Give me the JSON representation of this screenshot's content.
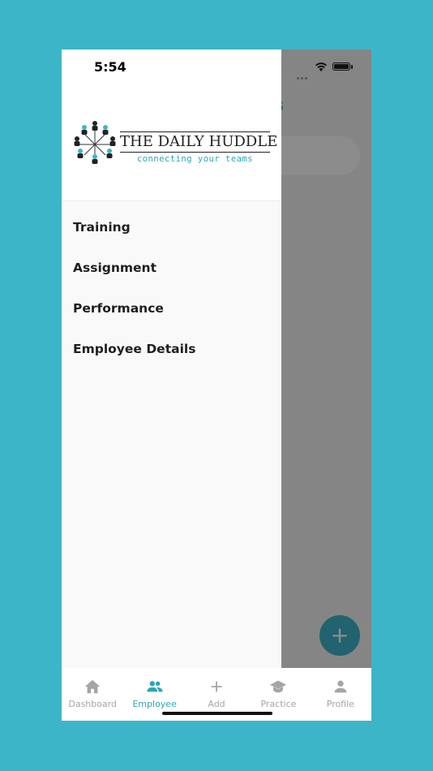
{
  "status_bar": {
    "time": "5:54"
  },
  "background_screen": {
    "title_fragment": "s",
    "fab_label": "+"
  },
  "brand": {
    "title": "THE DAILY HUDDLE",
    "tagline": "connecting your teams",
    "accent_color": "#3db5c9"
  },
  "drawer": {
    "items": [
      {
        "label": "Training"
      },
      {
        "label": "Assignment"
      },
      {
        "label": "Performance"
      },
      {
        "label": "Employee Details"
      }
    ]
  },
  "tabbar": {
    "tabs": [
      {
        "label": "Dashboard",
        "icon": "home-icon"
      },
      {
        "label": "Employee",
        "icon": "people-icon",
        "active": true
      },
      {
        "label": "Add",
        "icon": "plus-icon"
      },
      {
        "label": "Practice",
        "icon": "graduation-cap-icon"
      },
      {
        "label": "Profile",
        "icon": "person-icon"
      }
    ]
  }
}
